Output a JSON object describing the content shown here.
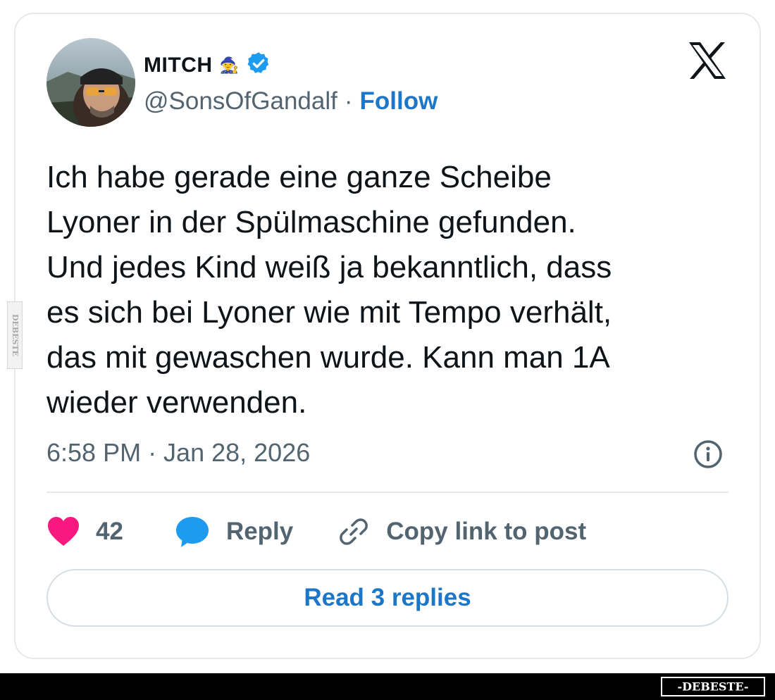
{
  "author": {
    "display_name": "MITCH",
    "name_emoji": "🧙",
    "handle": "@SonsOfGandalf",
    "separator": "·",
    "follow_label": "Follow",
    "verified": true
  },
  "tweet": {
    "text": "Ich habe gerade eine ganze Scheibe\nLyoner in der Spülmaschine gefunden.\nUnd jedes Kind weiß ja bekanntlich, dass\nes sich bei Lyoner wie mit Tempo verhält,\ndas mit gewaschen wurde. Kann man 1A\nwieder verwenden.",
    "timestamp": "6:58 PM · Jan 28, 2026"
  },
  "actions": {
    "like_count": "42",
    "reply_label": "Reply",
    "copy_link_label": "Copy link to post"
  },
  "read_replies_label": "Read 3 replies",
  "watermark": {
    "bottom": "-DEBESTE-",
    "side": "DEBESTE"
  },
  "colors": {
    "link_blue": "#1d77c8",
    "verified_blue": "#1d9bf0",
    "like_pink": "#f91880",
    "reply_blue": "#1d9bf0",
    "muted_gray": "#536471"
  },
  "icons": {
    "verified": "verified-badge-icon",
    "logo": "x-logo-icon",
    "info": "info-icon",
    "like": "heart-icon",
    "reply": "speech-bubble-icon",
    "copy": "link-icon"
  }
}
